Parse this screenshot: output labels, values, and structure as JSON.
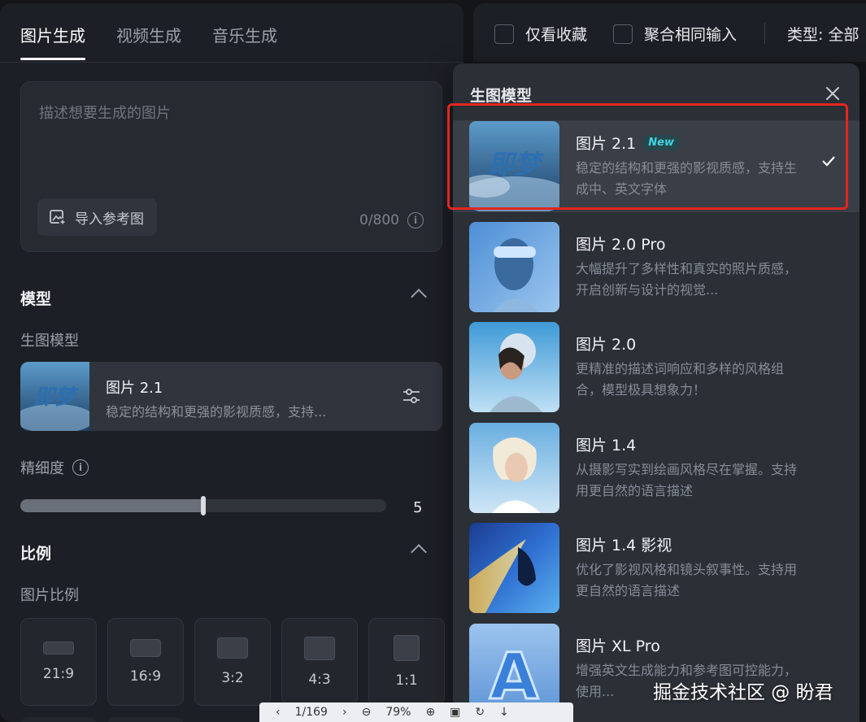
{
  "tabs": [
    "图片生成",
    "视频生成",
    "音乐生成"
  ],
  "prompt": {
    "placeholder": "描述想要生成的图片",
    "import_label": "导入参考图",
    "counter": "0/800"
  },
  "model_section": {
    "title": "模型",
    "label": "生图模型",
    "selected": {
      "name": "图片 2.1",
      "desc": "稳定的结构和更强的影视质感，支持..."
    }
  },
  "detail": {
    "label": "精细度",
    "value": "5",
    "fraction": 0.5
  },
  "ratio_section": {
    "title": "比例",
    "label": "图片比例",
    "ratios": [
      "21:9",
      "16:9",
      "3:2",
      "4:3",
      "1:1"
    ]
  },
  "top_bar": {
    "favorites": "仅看收藏",
    "merge": "聚合相同输入",
    "type": "类型: 全部"
  },
  "dropdown": {
    "title": "生图模型",
    "items": [
      {
        "name": "图片 2.1",
        "badge": "New",
        "desc": "稳定的结构和更强的影视质感，支持生成中、英文字体",
        "selected": true
      },
      {
        "name": "图片 2.0 Pro",
        "badge": "",
        "desc": "大幅提升了多样性和真实的照片质感，开启创新与设计的视觉...",
        "selected": false
      },
      {
        "name": "图片 2.0",
        "badge": "",
        "desc": "更精准的描述词响应和多样的风格组合，模型极具想象力！",
        "selected": false
      },
      {
        "name": "图片 1.4",
        "badge": "",
        "desc": "从摄影写实到绘画风格尽在掌握。支持用更自然的语言描述",
        "selected": false
      },
      {
        "name": "图片 1.4 影视",
        "badge": "",
        "desc": "优化了影视风格和镜头叙事性。支持用更自然的语言描述",
        "selected": false
      },
      {
        "name": "图片 XL Pro",
        "badge": "",
        "desc": "增强英文生成能力和参考图可控能力，使用...",
        "selected": false
      }
    ]
  },
  "toolbar": {
    "page": "1/169",
    "zoom": "79%"
  },
  "watermark": "掘金技术社区 @ 盼君",
  "colors": {
    "highlight": "#e3261f",
    "new_badge": "#3fd4e0"
  }
}
